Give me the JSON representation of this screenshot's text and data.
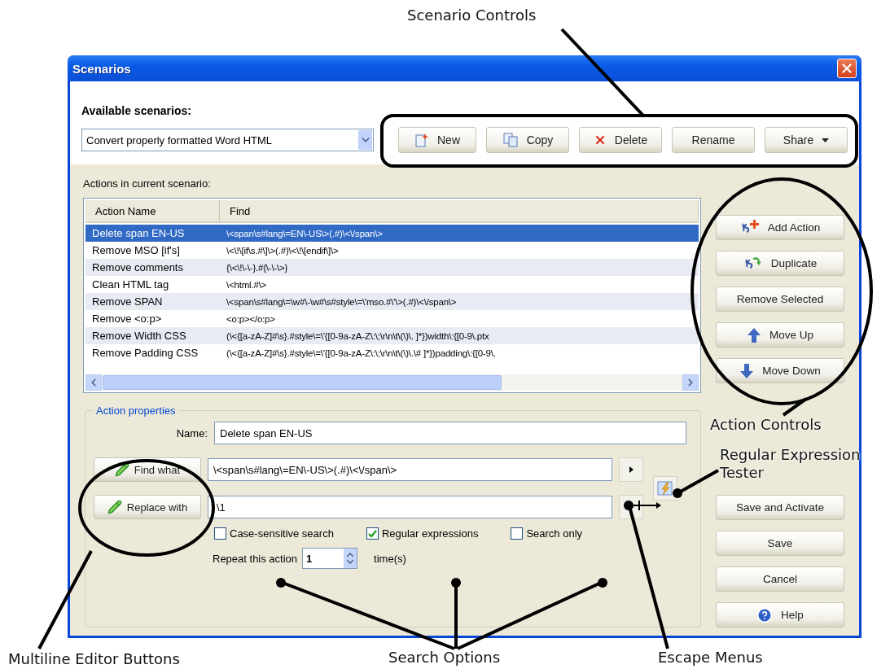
{
  "window": {
    "title": "Scenarios"
  },
  "scenario_picker": {
    "label": "Available scenarios:",
    "value": "Convert properly formatted Word HTML"
  },
  "scenario_buttons": [
    {
      "label": "New",
      "kind": "new"
    },
    {
      "label": "Copy",
      "kind": "copy"
    },
    {
      "label": "Delete",
      "kind": "delete"
    },
    {
      "label": "Rename",
      "kind": "plain"
    },
    {
      "label": "Share",
      "kind": "menu"
    }
  ],
  "actions_label": "Actions in current scenario:",
  "table": {
    "columns": [
      "Action Name",
      "Find"
    ],
    "rows": [
      {
        "name": "Delete span EN-US",
        "find": "\\<span\\s#lang\\=EN\\-US\\>(.#)\\<\\/span\\>",
        "selected": true
      },
      {
        "name": "Remove MSO [if's]",
        "find": "\\<\\!\\[if\\s.#\\]\\>(.#)\\<\\!\\[endif\\]\\>",
        "selected": false
      },
      {
        "name": "Remove comments",
        "find": "{\\<\\!\\-\\-}.#{\\-\\-\\>}",
        "selected": false
      },
      {
        "name": "Clean HTML tag",
        "find": "\\<html.#\\>",
        "selected": false
      },
      {
        "name": "Remove SPAN",
        "find": "\\<span\\s#lang\\=\\w#\\-\\w#\\s#style\\=\\'mso.#\\'\\>(.#)\\<\\/span\\>",
        "selected": false
      },
      {
        "name": "Remove <o:p>",
        "find": "<o:p></o:p>",
        "selected": false
      },
      {
        "name": "Remove Width CSS",
        "find": "(\\<{[a-zA-Z]#\\s}.#style\\=\\'{[0-9a-zA-Z\\:\\;\\r\\n\\t\\(\\)\\. ]*})width\\:{[0-9\\.ptx",
        "selected": false
      },
      {
        "name": "Remove Padding CSS",
        "find": "(\\<{[a-zA-Z]#\\s}.#style\\=\\'{[0-9a-zA-Z\\:\\;\\r\\n\\t\\(\\)\\.\\# ]*})padding\\:{[0-9\\.",
        "selected": false
      }
    ]
  },
  "action_buttons": [
    {
      "label": "Add Action",
      "kind": "add"
    },
    {
      "label": "Duplicate",
      "kind": "duplicate"
    },
    {
      "label": "Remove Selected",
      "kind": "plain"
    },
    {
      "label": "Move Up",
      "kind": "up"
    },
    {
      "label": "Move Down",
      "kind": "down"
    }
  ],
  "properties": {
    "title": "Action properties",
    "name_label": "Name:",
    "name_value": "Delete span EN-US",
    "find_button": "Find what",
    "find_value": "\\<span\\s#lang\\=EN\\-US\\>(.#)\\<\\/span\\>",
    "replace_button": "Replace with",
    "replace_value": "\\1",
    "options": [
      {
        "label": "Case-sensitive search",
        "checked": false
      },
      {
        "label": "Regular expressions",
        "checked": true
      },
      {
        "label": "Search only",
        "checked": false
      }
    ],
    "repeat_label": "Repeat this action",
    "repeat_value": "1",
    "repeat_unit": "time(s)"
  },
  "dialog_buttons": [
    {
      "label": "Save and Activate",
      "kind": "plain"
    },
    {
      "label": "Save",
      "kind": "plain"
    },
    {
      "label": "Cancel",
      "kind": "plain"
    },
    {
      "label": "Help",
      "kind": "help"
    }
  ],
  "callouts": [
    "Scenario Controls",
    "Action Controls",
    "Regular Expression Tester",
    "Multiline Editor Buttons",
    "Search Options",
    "Escape Menus"
  ]
}
